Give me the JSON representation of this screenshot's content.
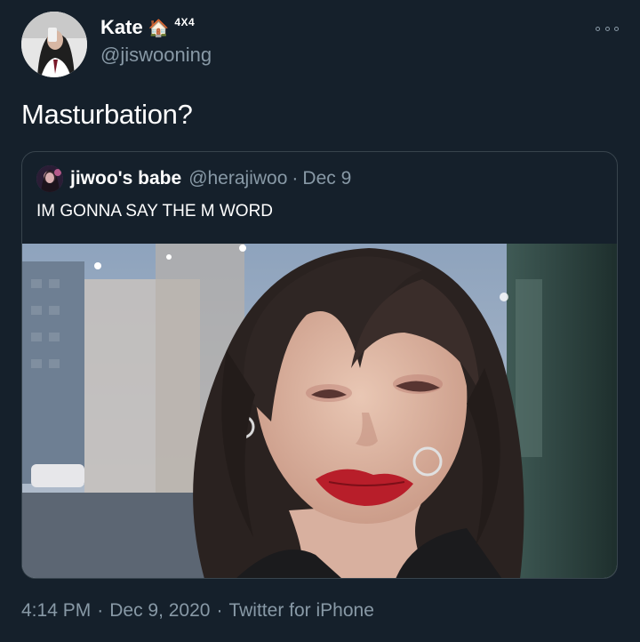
{
  "author": {
    "display_name": "Kate",
    "name_emoji": "🏠",
    "name_suffix": "4X4",
    "handle": "@jiswooning",
    "avatar_icon": "profile-photo"
  },
  "tweet": {
    "text": "Masturbation?"
  },
  "more_icon": "more-options-icon",
  "quoted_tweet": {
    "display_name": "jiwoo's babe",
    "handle": "@herajiwoo",
    "separator": "·",
    "date": "Dec 9",
    "text": "IM GONNA SAY THE M WORD",
    "media_icon": "photo"
  },
  "meta": {
    "time": "4:14 PM",
    "separator": "·",
    "date": "Dec 9, 2020",
    "source": "Twitter for iPhone"
  },
  "colors": {
    "background": "#15202b",
    "secondary_text": "#8899a6",
    "border": "#38444d"
  }
}
